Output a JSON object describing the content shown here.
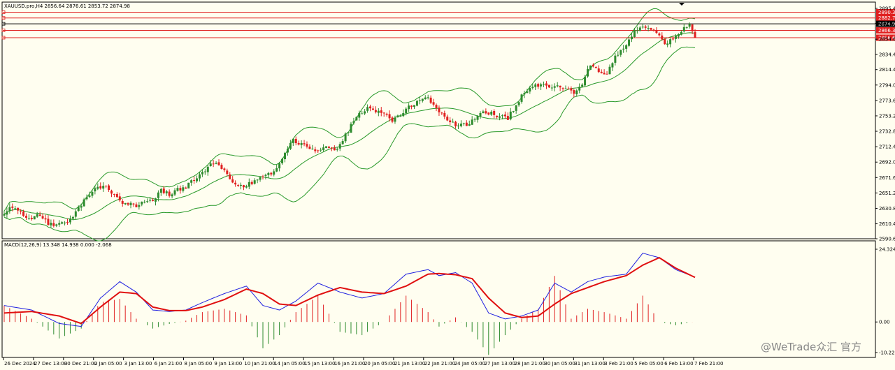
{
  "header": {
    "symbol_info": "XAUUSD.pro,H4  2856.64 2876.61 2853.72 2874.98",
    "macd_info": "MACD(12,26,9) 13.348 14.938 0.000 -2.068"
  },
  "watermark": "@WeTrade众汇 官方",
  "colors": {
    "background": "#fffef0",
    "bull": "#2e8b2e",
    "bear": "#e02020",
    "band": "#2a9a2a",
    "macd_line": "#2020e0",
    "signal_line": "#e01010",
    "level_line": "#e02020",
    "price_line": "#000000"
  },
  "levels": [
    {
      "value": "2890.30",
      "color": "#e02020"
    },
    {
      "value": "2882.73",
      "color": "#e02020"
    },
    {
      "value": "2874.98",
      "color": "#000000"
    },
    {
      "value": "2866.32",
      "color": "#e02020"
    },
    {
      "value": "2856.62",
      "color": "#e02020"
    }
  ],
  "chart_data": [
    {
      "type": "candlestick",
      "title": "XAUUSD.pro,H4",
      "indicator": "Bollinger Bands",
      "y_ticks": [
        "2895.40",
        "2875.60",
        "2854.60",
        "2834.40",
        "2814.40",
        "2794.00",
        "2773.60",
        "2753.20",
        "2732.80",
        "2712.40",
        "2692.00",
        "2671.60",
        "2651.20",
        "2630.80",
        "2610.40",
        "2590.60"
      ],
      "ylim": [
        2590.6,
        2895.4
      ],
      "x_ticks": [
        "26 Dec 2024",
        "27 Dec 13:00",
        "30 Dec 21:00",
        "2 Jan 05:00",
        "3 Jan 13:00",
        "6 Jan 21:00",
        "8 Jan 05:00",
        "9 Jan 13:00",
        "10 Jan 21:00",
        "14 Jan 05:00",
        "15 Jan 13:00",
        "16 Jan 21:00",
        "20 Jan 05:00",
        "21 Jan 13:00",
        "22 Jan 21:00",
        "24 Jan 05:00",
        "27 Jan 13:00",
        "28 Jan 21:00",
        "30 Jan 05:00",
        "31 Jan 13:00",
        "3 Feb 21:00",
        "5 Feb 05:00",
        "6 Feb 13:00",
        "7 Feb 21:00"
      ],
      "close_path": [
        [
          0,
          2626
        ],
        [
          3,
          2632
        ],
        [
          6,
          2625
        ],
        [
          9,
          2618
        ],
        [
          12,
          2622
        ],
        [
          15,
          2614
        ],
        [
          18,
          2607
        ],
        [
          21,
          2610
        ],
        [
          24,
          2618
        ],
        [
          27,
          2630
        ],
        [
          30,
          2645
        ],
        [
          33,
          2656
        ],
        [
          36,
          2662
        ],
        [
          39,
          2653
        ],
        [
          42,
          2641
        ],
        [
          45,
          2636
        ],
        [
          48,
          2634
        ],
        [
          51,
          2638
        ],
        [
          54,
          2640
        ],
        [
          57,
          2654
        ],
        [
          60,
          2650
        ],
        [
          63,
          2655
        ],
        [
          66,
          2660
        ],
        [
          69,
          2668
        ],
        [
          72,
          2678
        ],
        [
          75,
          2688
        ],
        [
          78,
          2690
        ],
        [
          81,
          2676
        ],
        [
          84,
          2662
        ],
        [
          87,
          2660
        ],
        [
          90,
          2664
        ],
        [
          93,
          2670
        ],
        [
          96,
          2675
        ],
        [
          99,
          2685
        ],
        [
          102,
          2705
        ],
        [
          105,
          2722
        ],
        [
          108,
          2716
        ],
        [
          111,
          2712
        ],
        [
          114,
          2706
        ],
        [
          117,
          2710
        ],
        [
          120,
          2708
        ],
        [
          123,
          2720
        ],
        [
          126,
          2740
        ],
        [
          129,
          2755
        ],
        [
          132,
          2762
        ],
        [
          135,
          2760
        ],
        [
          138,
          2756
        ],
        [
          141,
          2746
        ],
        [
          144,
          2755
        ],
        [
          147,
          2764
        ],
        [
          150,
          2772
        ],
        [
          153,
          2778
        ],
        [
          156,
          2770
        ],
        [
          159,
          2755
        ],
        [
          162,
          2745
        ],
        [
          165,
          2740
        ],
        [
          168,
          2742
        ],
        [
          171,
          2750
        ],
        [
          174,
          2757
        ],
        [
          177,
          2757
        ],
        [
          180,
          2752
        ],
        [
          183,
          2750
        ],
        [
          186,
          2768
        ],
        [
          189,
          2785
        ],
        [
          192,
          2792
        ],
        [
          195,
          2796
        ],
        [
          198,
          2793
        ],
        [
          201,
          2792
        ],
        [
          204,
          2790
        ],
        [
          207,
          2782
        ],
        [
          210,
          2795
        ],
        [
          213,
          2822
        ],
        [
          216,
          2812
        ],
        [
          219,
          2808
        ],
        [
          222,
          2830
        ],
        [
          225,
          2843
        ],
        [
          228,
          2860
        ],
        [
          231,
          2872
        ],
        [
          234,
          2872
        ],
        [
          237,
          2862
        ],
        [
          240,
          2848
        ],
        [
          243,
          2855
        ],
        [
          246,
          2866
        ],
        [
          249,
          2876
        ],
        [
          251,
          2858
        ]
      ],
      "volatility_seed": 20250207
    },
    {
      "type": "macd",
      "title": "MACD(12,26,9)",
      "y_ticks": [
        "24.324",
        "0.00",
        "-10.22"
      ],
      "ylim": [
        -10.22,
        24.324
      ],
      "current": {
        "macd": 13.348,
        "signal": 14.938,
        "hist_main": 0.0,
        "hist_alt": -2.068
      },
      "macd_path": [
        [
          0,
          5.5
        ],
        [
          10,
          4
        ],
        [
          20,
          -0.5
        ],
        [
          28,
          -1.5
        ],
        [
          35,
          8
        ],
        [
          42,
          13.5
        ],
        [
          48,
          10
        ],
        [
          54,
          4
        ],
        [
          60,
          3.5
        ],
        [
          66,
          4
        ],
        [
          72,
          6.5
        ],
        [
          80,
          9.5
        ],
        [
          88,
          12
        ],
        [
          94,
          5.5
        ],
        [
          100,
          4
        ],
        [
          106,
          7
        ],
        [
          114,
          13
        ],
        [
          122,
          10
        ],
        [
          130,
          8
        ],
        [
          138,
          9.5
        ],
        [
          146,
          16
        ],
        [
          154,
          17.5
        ],
        [
          158,
          15.5
        ],
        [
          164,
          16.5
        ],
        [
          170,
          13
        ],
        [
          176,
          3
        ],
        [
          182,
          1
        ],
        [
          188,
          2
        ],
        [
          194,
          4
        ],
        [
          200,
          13
        ],
        [
          206,
          10
        ],
        [
          212,
          13.5
        ],
        [
          218,
          15
        ],
        [
          226,
          16
        ],
        [
          232,
          23
        ],
        [
          238,
          21.5
        ],
        [
          244,
          17.5
        ],
        [
          251,
          15
        ]
      ],
      "signal_path": [
        [
          0,
          3
        ],
        [
          10,
          3.5
        ],
        [
          20,
          2
        ],
        [
          28,
          -0.5
        ],
        [
          35,
          5
        ],
        [
          42,
          10
        ],
        [
          48,
          9.5
        ],
        [
          54,
          5
        ],
        [
          60,
          3.8
        ],
        [
          66,
          3.8
        ],
        [
          72,
          5
        ],
        [
          80,
          7.5
        ],
        [
          88,
          11
        ],
        [
          94,
          9.5
        ],
        [
          100,
          6
        ],
        [
          106,
          5.5
        ],
        [
          114,
          9
        ],
        [
          122,
          11.5
        ],
        [
          130,
          10
        ],
        [
          138,
          9.5
        ],
        [
          146,
          12
        ],
        [
          154,
          16
        ],
        [
          158,
          16.2
        ],
        [
          164,
          15.8
        ],
        [
          170,
          14.5
        ],
        [
          176,
          8
        ],
        [
          182,
          3
        ],
        [
          188,
          1.5
        ],
        [
          194,
          2
        ],
        [
          200,
          6
        ],
        [
          206,
          9.5
        ],
        [
          212,
          11.5
        ],
        [
          218,
          13.5
        ],
        [
          226,
          15.5
        ],
        [
          232,
          19
        ],
        [
          238,
          21.5
        ],
        [
          244,
          18
        ],
        [
          251,
          14.9
        ]
      ]
    }
  ]
}
